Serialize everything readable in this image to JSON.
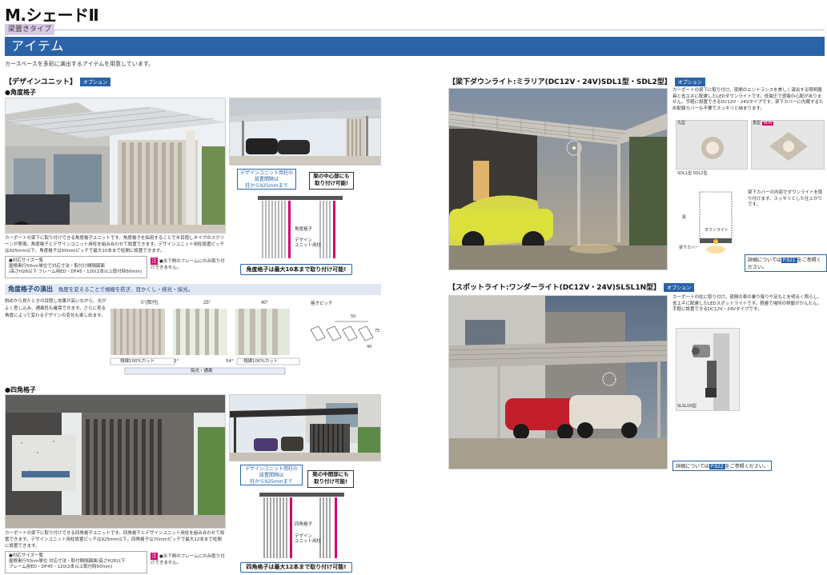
{
  "page": {
    "title": "M.シェードⅡ",
    "tag": "梁置きタイプ",
    "section": "アイテム",
    "intro": "カースペースを多彩に演出するアイテムを用意しています。"
  },
  "design_unit": {
    "head": "【デザインユニット】",
    "badge": "オプション",
    "kakudo": {
      "head": "●角度格子",
      "caption": "カーポートの梁下に取り付けできる角度格子ユニットです。角度格子を採用することで半目隠しタイプのスクリーンが実現。角度格子とデザインユニット用柱を組み合わせて設置できます。デザインユニット用柱設置ピッチは925mm以下。角度格子は50mmピッチで最大10本まで柱間に設置できます。",
      "size_box": "●対応サイズ一覧\n屋根奥行50cm単位で対応寸法・取付け間隔図面\n/高さH26以下 フレーム用ED・DF45・120(2本以上取付時50mm)",
      "note": "●水下側のフレームにのみ取り付けできません。",
      "callout_blue": "デザインユニット用柱の\n設置間隔は\n柱から925mmまで",
      "callout_black": "梁の中心部にも\n取り付け可能!",
      "label1": "角度格子",
      "label2": "デザイン\nユニット用柱",
      "max": "角度格子は最大10本まで取り付け可能!"
    },
    "angle_strip": {
      "head": "角度格子の演出",
      "sub": "角度を変えることで視線を防ぎ、目かくし・排光・採光。",
      "text": "斜めから見たときの目隠し効果が高いながら、光がよく差し込み、通風性も確保できます。さらに見る角度によって変わるデザインの変化も楽しめます。",
      "angles": [
        "0°(取付)",
        "25°",
        "40°"
      ],
      "bar_left": "視線100%カット",
      "bar_right": "視線100%カット",
      "deg_left": "2°",
      "deg_right": "54°",
      "bar_bottom": "採光・通風",
      "pitch_label": "格子ピッチ",
      "pitch_values": [
        "50",
        "75",
        "40"
      ]
    },
    "shikaku": {
      "head": "●四角格子",
      "caption": "カーポートの梁下に取り付けできる四角格子ユニットです。四角格子とデザインユニット用柱を組み合わせて設置できます。デザインユニット用柱設置ピッチは925mm以下。四角格子は70mmピッチで最大12本まで柱間に設置できます。",
      "size_box": "●対応サイズ一覧\n屋根奥行50cm単位 対応寸法・取付間隔図面/高さH26以下\nフレーム用ED・DF45・120(2本以上取付時50mm)",
      "note": "●水下側のフレームにのみ取り付けできません。",
      "callout_blue": "デザインユニット用柱の\n設置間隔は\n柱から925mmまで",
      "callout_black": "梁の中間部にも\n取り付け可能!",
      "label1": "四角格子",
      "label2": "デザイン\nユニット用柱",
      "max": "四角格子は最大12本まで取り付け可能!"
    }
  },
  "downlight": {
    "head": "【梁下ダウンライト:ミラリア(DC12V・24V)SDL1型・SDL2型】",
    "badge": "オプション",
    "text": "カーポートの梁下に取り付け。夜間のエントランスを美しく演出する照明器具と省エネに配慮したLEDダウンライトです。低電圧で感電の心配がありません。手軽に設置できるDC12V・24Vタイプです。梁下カバーに内蔵するため配線カバーも不要でスッキリと納まります。",
    "type1": "丸型",
    "type2": "角型",
    "type2_badge": "NEW",
    "model": "SDL1型 SDL2型",
    "label_beam": "梁",
    "label_light": "ダウンライト",
    "label_cover": "梁下カバー",
    "text2": "梁下カバーの内部でダウンライトを取り付けます。スッキリとした仕上がりです。",
    "ref": "詳細については",
    "ref_page": "P.921",
    "ref_end": "をご参照ください。"
  },
  "spotlight": {
    "head": "【スポットライト:ワンダーライト(DC12V・24V)SLSL1N型】",
    "badge": "オプション",
    "text": "カーポートの柱に取り付け。夜間の車の乗り降りや足もとを明るく照らし、省エネに配慮したLEDスポットライトです。軽量で場所の移動がかんたん。手軽に設置できるDC12V・24Vタイプです。",
    "model": "SLSL1N型",
    "ref": "詳細については",
    "ref_page": "P.922",
    "ref_end": "をご参照ください。"
  },
  "colors": {
    "blue": "#2a63a8",
    "lavender": "#d8c9e6",
    "magenta": "#d6006e"
  }
}
